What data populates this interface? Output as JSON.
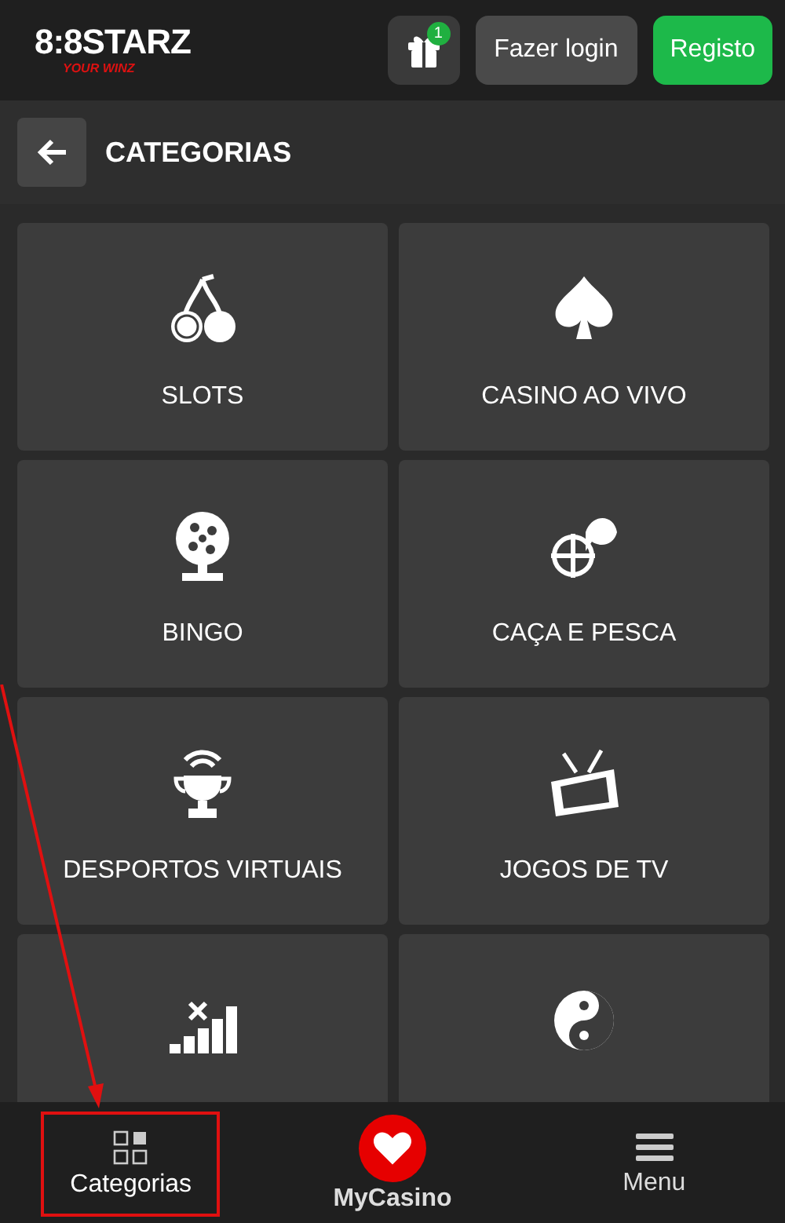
{
  "header": {
    "logo_main": "8:8STARZ",
    "logo_tagline": "YOUR WINZ",
    "gift_badge": "1",
    "login_button": "Fazer login",
    "register_button": "Registo"
  },
  "subheader": {
    "title": "CATEGORIAS"
  },
  "categories": [
    {
      "kind": "cherries",
      "label": "SLOTS"
    },
    {
      "kind": "spade",
      "label": "CASINO AO VIVO"
    },
    {
      "kind": "lottery",
      "label": "BINGO"
    },
    {
      "kind": "fishing",
      "label": "CAÇA E PESCA"
    },
    {
      "kind": "trophy",
      "label": "DESPORTOS VIRTUAIS"
    },
    {
      "kind": "tv",
      "label": "JOGOS DE TV"
    },
    {
      "kind": "crash"
    },
    {
      "kind": "yinyang"
    }
  ],
  "bottom_nav": [
    {
      "kind": "grid",
      "label": "Categorias",
      "selected": true,
      "highlighted": true
    },
    {
      "kind": "heart",
      "label": "MyCasino",
      "selected": false,
      "highlighted": false
    },
    {
      "kind": "menu",
      "label": "Menu",
      "selected": false,
      "highlighted": false
    }
  ]
}
